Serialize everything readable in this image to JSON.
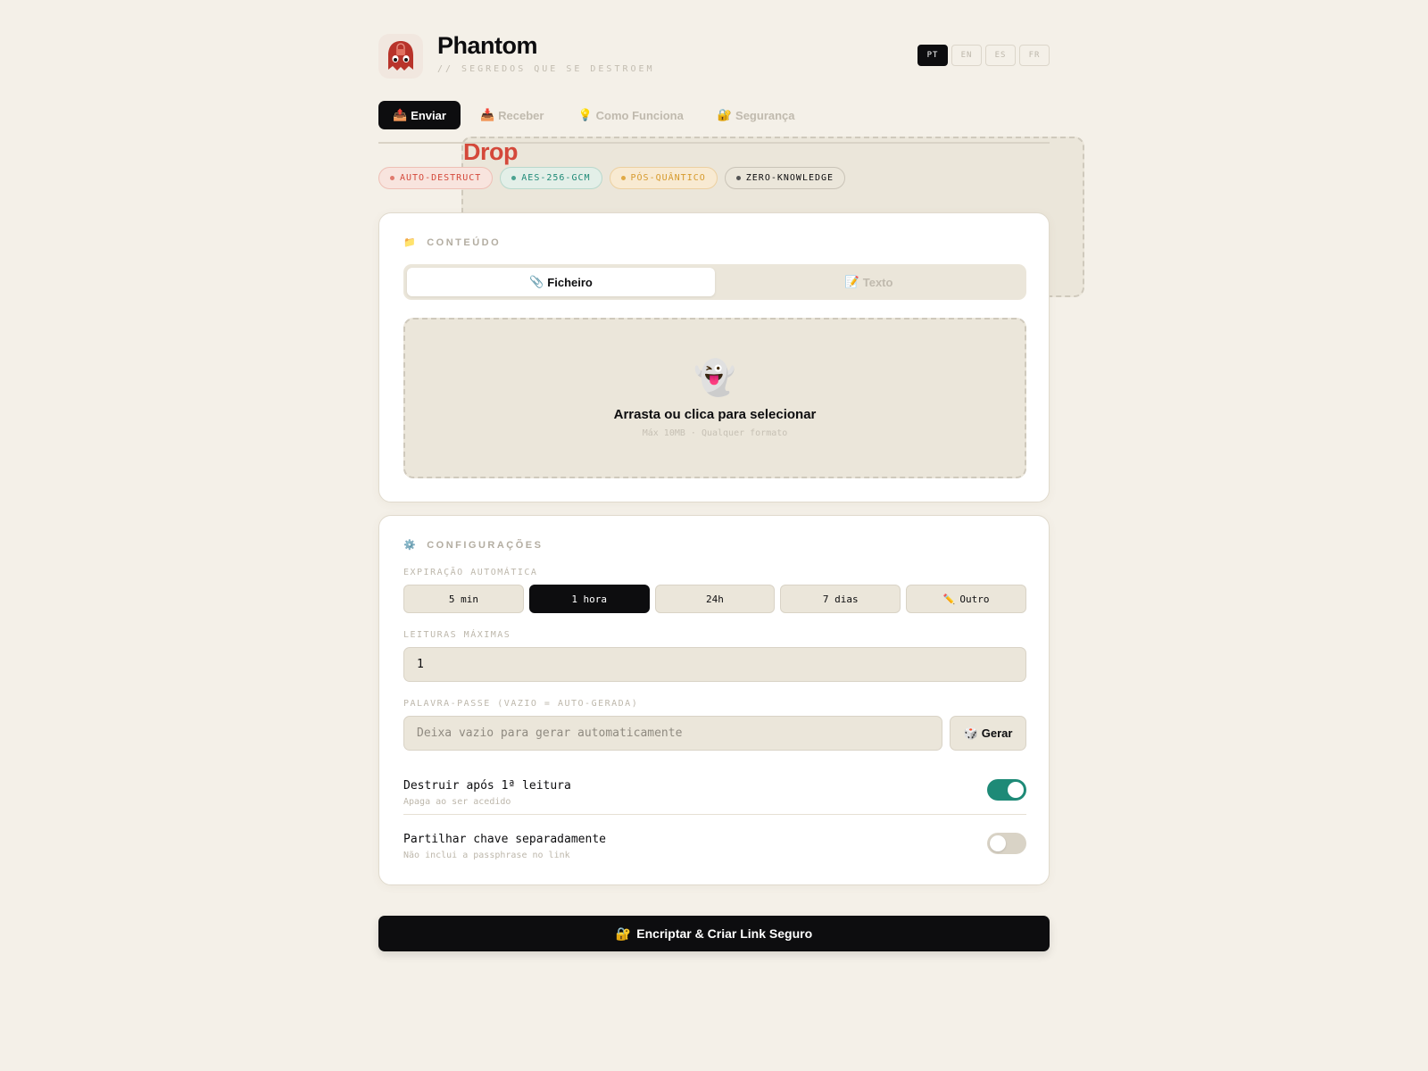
{
  "header": {
    "brand_main": "Phantom",
    "brand_accent": "Drop",
    "tagline": "// SEGREDOS QUE SE DESTROEM",
    "languages": [
      "PT",
      "EN",
      "ES",
      "FR"
    ],
    "active_language": "PT"
  },
  "nav": {
    "tabs": [
      {
        "icon": "📤",
        "label": "Enviar",
        "active": true
      },
      {
        "icon": "📥",
        "label": "Receber",
        "active": false
      },
      {
        "icon": "💡",
        "label": "Como Funciona",
        "active": false
      },
      {
        "icon": "🔐",
        "label": "Segurança",
        "active": false
      }
    ]
  },
  "badges": [
    {
      "label": "AUTO-DESTRUCT",
      "color": "#d4483a",
      "bg": "#f8e4de",
      "border": "#eebfb5"
    },
    {
      "label": "AES-256-GCM",
      "color": "#1e8a77",
      "bg": "#e3efe8",
      "border": "#b8d8cc"
    },
    {
      "label": "PÓS-QUÂNTICO",
      "color": "#d69a2c",
      "bg": "#f8ead2",
      "border": "#ecd0a0"
    },
    {
      "label": "ZERO-KNOWLEDGE",
      "color": "#0d0d0f",
      "bg": "#ebe6da",
      "border": "#c9c3b7"
    }
  ],
  "content_card": {
    "icon": "📁",
    "title": "CONTEÚDO",
    "tabs": [
      {
        "icon": "📎",
        "label": "Ficheiro",
        "active": true
      },
      {
        "icon": "📝",
        "label": "Texto",
        "active": false
      }
    ],
    "dropzone": {
      "icon": "👻",
      "title": "Arrasta ou clica para selecionar",
      "subtitle": "Máx 10MB · Qualquer formato"
    }
  },
  "config_card": {
    "icon": "⚙️",
    "title": "CONFIGURAÇÕES",
    "expiration_label": "EXPIRAÇÃO AUTOMÁTICA",
    "expiration_options": [
      "5 min",
      "1 hora",
      "24h",
      "7 dias",
      "Outro"
    ],
    "expiration_other_icon": "✏️",
    "expiration_selected": "1 hora",
    "max_reads_label": "LEITURAS MÁXIMAS",
    "max_reads_value": "1",
    "password_label": "PALAVRA-PASSE (VAZIO = AUTO-GERADA)",
    "password_placeholder": "Deixa vazio para gerar automaticamente",
    "generate_icon": "🎲",
    "generate_label": "Gerar",
    "toggles": [
      {
        "title": "Destruir após 1ª leitura",
        "subtitle": "Apaga ao ser acedido",
        "on": true
      },
      {
        "title": "Partilhar chave separadamente",
        "subtitle": "Não inclui a passphrase no link",
        "on": false
      }
    ]
  },
  "cta": {
    "icon": "🔐",
    "label": "Encriptar & Criar Link Seguro"
  },
  "colors": {
    "accent": "#d4483a",
    "background": "#f4f0e8",
    "toggle_on": "#1e8a77",
    "dark": "#0d0d0f"
  }
}
